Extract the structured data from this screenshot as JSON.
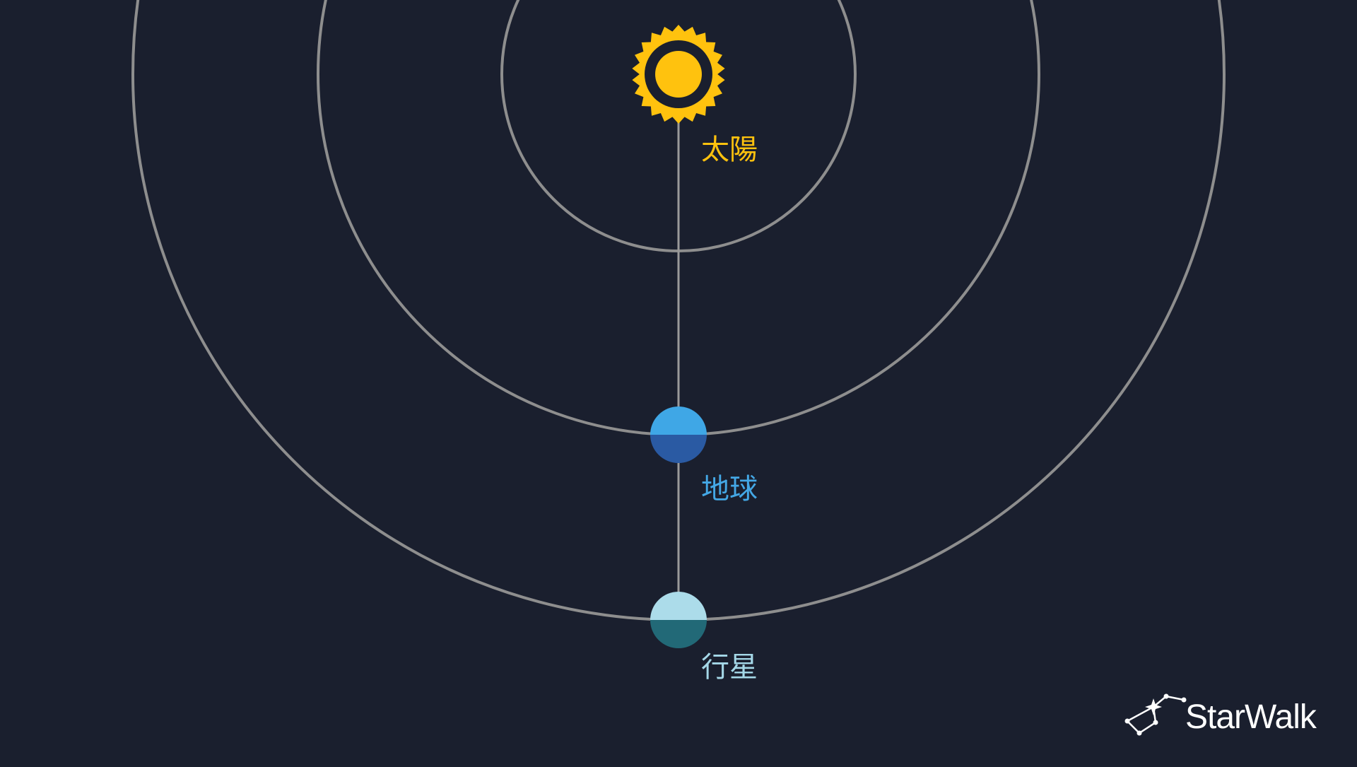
{
  "diagram": {
    "labels": {
      "sun": "太陽",
      "earth": "地球",
      "planet": "行星"
    },
    "colors": {
      "background": "#1a1f2e",
      "orbit": "#8e8e8e",
      "connector": "#9a9a9a",
      "sun": "#ffc20e",
      "earth_top": "#3fa7e6",
      "earth_bottom": "#2a5aa3",
      "planet_top": "#acdcea",
      "planet_bottom": "#226977",
      "earth_label": "#44a8e6",
      "planet_label": "#a5d8e8"
    },
    "icons": {
      "sun": "sun-icon",
      "earth": "earth-icon",
      "planet": "planet-icon",
      "logo": "starwalk-constellation-icon"
    }
  },
  "branding": {
    "logo_text": "StarWalk"
  }
}
